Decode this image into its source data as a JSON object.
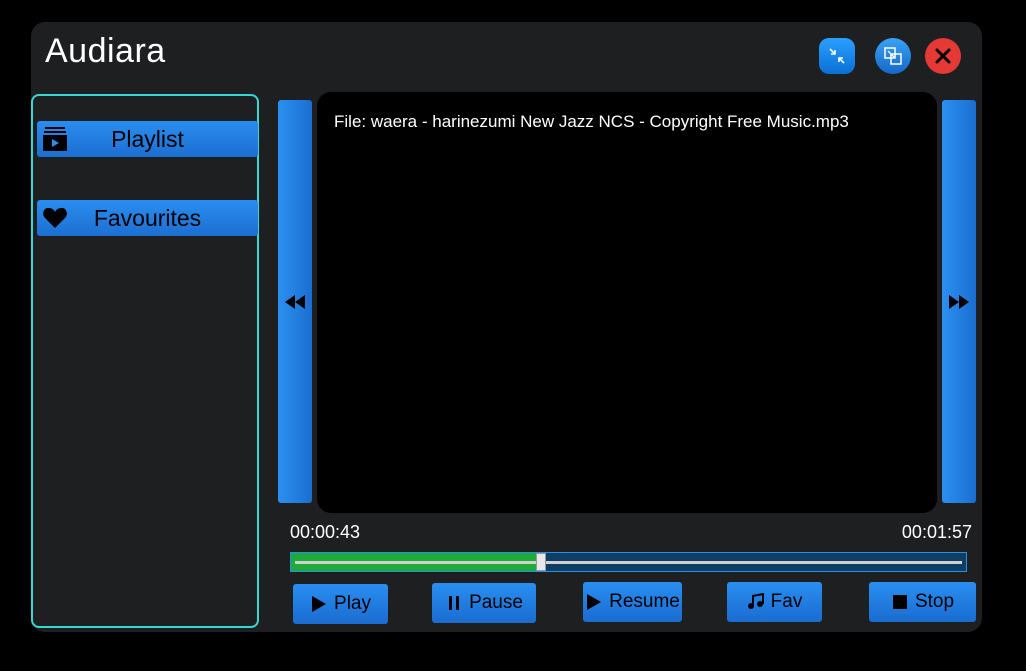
{
  "window": {
    "title": "Audiara"
  },
  "titlebar": {
    "minimize_icon": "shrink-arrows-icon",
    "maximize_icon": "expand-windows-icon",
    "close_icon": "close-x-icon"
  },
  "sidebar": {
    "items": [
      {
        "label": "Playlist",
        "icon": "playlist-icon"
      },
      {
        "label": "Favourites",
        "icon": "heart-icon"
      }
    ]
  },
  "player": {
    "file_label": "File: waera - harinezumi New Jazz NCS - Copyright Free Music.mp3",
    "current_time": "00:00:43",
    "total_time": "00:01:57",
    "progress_fraction": 0.37
  },
  "controls": {
    "play_label": "Play",
    "pause_label": "Pause",
    "resume_label": "Resume",
    "fav_label": "Fav",
    "stop_label": "Stop"
  },
  "colors": {
    "accent_blue": "#2a8ef1",
    "sidebar_border": "#37d8d4",
    "progress_fill": "#1faa3a",
    "close_red": "#e53935"
  }
}
